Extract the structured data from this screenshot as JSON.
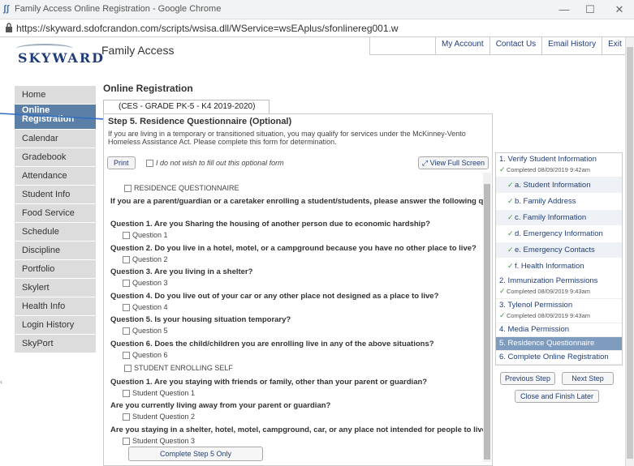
{
  "browser": {
    "window_title": "Family Access Online Registration - Google Chrome",
    "url": "https://skyward.sdofcrandon.com/scripts/wsisa.dll/WService=wsEAplus/sfonlinereg001.w"
  },
  "header": {
    "logo_text": "SKYWARD",
    "app_title": "Family Access",
    "links": [
      "My Account",
      "Contact Us",
      "Email History",
      "Exit"
    ]
  },
  "sidebar": {
    "items": [
      {
        "label": "Home"
      },
      {
        "label": "Online Registration"
      },
      {
        "label": "Calendar"
      },
      {
        "label": "Gradebook"
      },
      {
        "label": "Attendance"
      },
      {
        "label": "Student Info"
      },
      {
        "label": "Food Service"
      },
      {
        "label": "Schedule"
      },
      {
        "label": "Discipline"
      },
      {
        "label": "Portfolio"
      },
      {
        "label": "Skylert"
      },
      {
        "label": "Health Info"
      },
      {
        "label": "Login History"
      },
      {
        "label": "SkyPort"
      }
    ]
  },
  "main": {
    "page_title": "Online Registration",
    "tab_label": "(CES - GRADE PK-5 - K4 2019-2020)",
    "step_title": "Step 5. Residence Questionnaire (Optional)",
    "step_desc": "If you are living in a temporary or transitioned situation, you may qualify for services under the McKinney-Vento Homeless Assistance Act. Please complete this form for determination.",
    "print_label": "Print",
    "optout_label": "I do not wish to fill out this optional form",
    "view_full_label": "View Full Screen",
    "complete_label": "Complete Step 5 Only"
  },
  "form": {
    "section1": "RESIDENCE QUESTIONNAIRE",
    "intro": "If you are a parent/guardian or a caretaker enrolling a student/students, please answer the following qu",
    "questions": [
      {
        "q": "Question 1. Are you Sharing the housing of another person due to economic hardship?",
        "opt": "Question 1"
      },
      {
        "q": "Question 2. Do you live in a hotel, motel, or a campground because you have no other place to live?",
        "opt": "Question 2"
      },
      {
        "q": "Question 3. Are you living in a shelter?",
        "opt": "Question 3"
      },
      {
        "q": "Question 4. Do you live out of your car or any other place not designed as a place to live?",
        "opt": "Question 4"
      },
      {
        "q": "Question 5. Is your housing situation temporary?",
        "opt": "Question 5"
      },
      {
        "q": "Question 6. Does the child/children you are enrolling live in any of the above situations?",
        "opt": "Question 6"
      }
    ],
    "section2": "STUDENT ENROLLING SELF",
    "student_questions": [
      {
        "q": "Question 1. Are you staying with friends or family, other than your parent or guardian?",
        "opt": "Student Question 1"
      },
      {
        "q": "Are you currently living away from your parent or guardian?",
        "opt": "Student Question 2"
      },
      {
        "q": "Are you staying in a shelter, hotel, motel, campground, car, or any place not intended for people to live",
        "opt": "Student Question 3"
      }
    ]
  },
  "steps": {
    "step1": {
      "label": "1. Verify Student Information",
      "status": "Completed 08/09/2019 9:42am"
    },
    "step1_subs": [
      "a. Student Information",
      "b. Family Address",
      "c. Family Information",
      "d. Emergency Information",
      "e. Emergency Contacts",
      "f. Health Information"
    ],
    "step2": {
      "label": "2. Immunization Permissions",
      "status": "Completed 08/09/2019 9:43am"
    },
    "step3": {
      "label": "3. Tylenol Permission",
      "status": "Completed 08/09/2019 9:43am"
    },
    "step4": {
      "label": "4. Media Permission"
    },
    "step5": {
      "label": "5. Residence Questionnaire"
    },
    "step6": {
      "label": "6. Complete Online Registration"
    },
    "prev_label": "Previous Step",
    "next_label": "Next Step",
    "close_label": "Close and Finish Later"
  },
  "colors": {
    "nav_active": "#5b7fa6",
    "step_active": "#7f9cbf",
    "link": "#1f3d7a"
  }
}
